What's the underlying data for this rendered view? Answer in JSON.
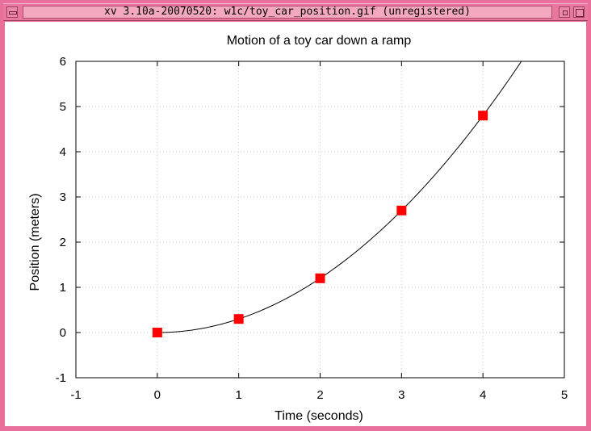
{
  "window": {
    "title": "xv 3.10a-20070520: w1c/toy_car_position.gif (unregistered)"
  },
  "chart_data": {
    "type": "scatter",
    "title": "Motion of a toy car down a ramp",
    "xlabel": "Time (seconds)",
    "ylabel": "Position (meters)",
    "xlim": [
      -1,
      5
    ],
    "ylim": [
      -1,
      6
    ],
    "xticks": [
      -1,
      0,
      1,
      2,
      3,
      4,
      5
    ],
    "yticks": [
      -1,
      0,
      1,
      2,
      3,
      4,
      5,
      6
    ],
    "grid": true,
    "points": [
      {
        "x": 0,
        "y": 0
      },
      {
        "x": 1,
        "y": 0.3
      },
      {
        "x": 2,
        "y": 1.2
      },
      {
        "x": 3,
        "y": 2.7
      },
      {
        "x": 4,
        "y": 4.8
      }
    ],
    "fit": {
      "type": "quadratic",
      "a": 0.3,
      "b": 0,
      "c": 0,
      "color": "#000000"
    },
    "marker_color": "#ff0000"
  },
  "colors": {
    "window_frame": "#e8709a",
    "grid": "#c8c8c8"
  }
}
